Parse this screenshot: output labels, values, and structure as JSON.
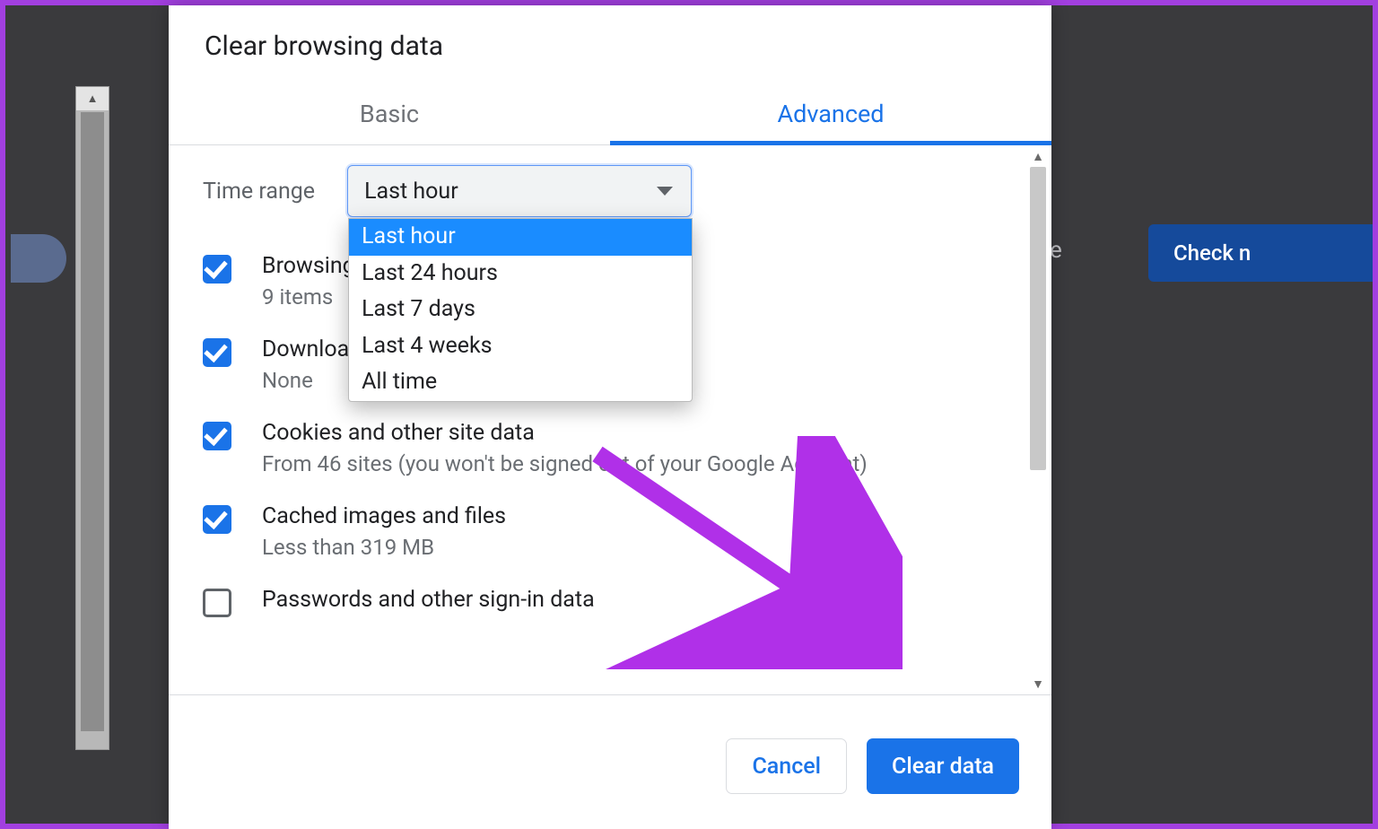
{
  "dialog": {
    "title": "Clear browsing data",
    "tabs": {
      "basic": "Basic",
      "advanced": "Advanced"
    },
    "time_range": {
      "label": "Time range",
      "selected": "Last hour",
      "options": [
        "Last hour",
        "Last 24 hours",
        "Last 7 days",
        "Last 4 weeks",
        "All time"
      ]
    },
    "items": [
      {
        "checked": true,
        "title": "Browsing history",
        "sub": "9 items"
      },
      {
        "checked": true,
        "title": "Download history",
        "sub": "None"
      },
      {
        "checked": true,
        "title": "Cookies and other site data",
        "sub": "From 46 sites (you won't be signed out of your Google Account)"
      },
      {
        "checked": true,
        "title": "Cached images and files",
        "sub": "Less than 319 MB"
      },
      {
        "checked": false,
        "title": "Passwords and other sign-in data",
        "sub": ""
      }
    ],
    "buttons": {
      "cancel": "Cancel",
      "clear": "Clear data"
    }
  },
  "background": {
    "check_button": "Check n",
    "letter": "e"
  }
}
